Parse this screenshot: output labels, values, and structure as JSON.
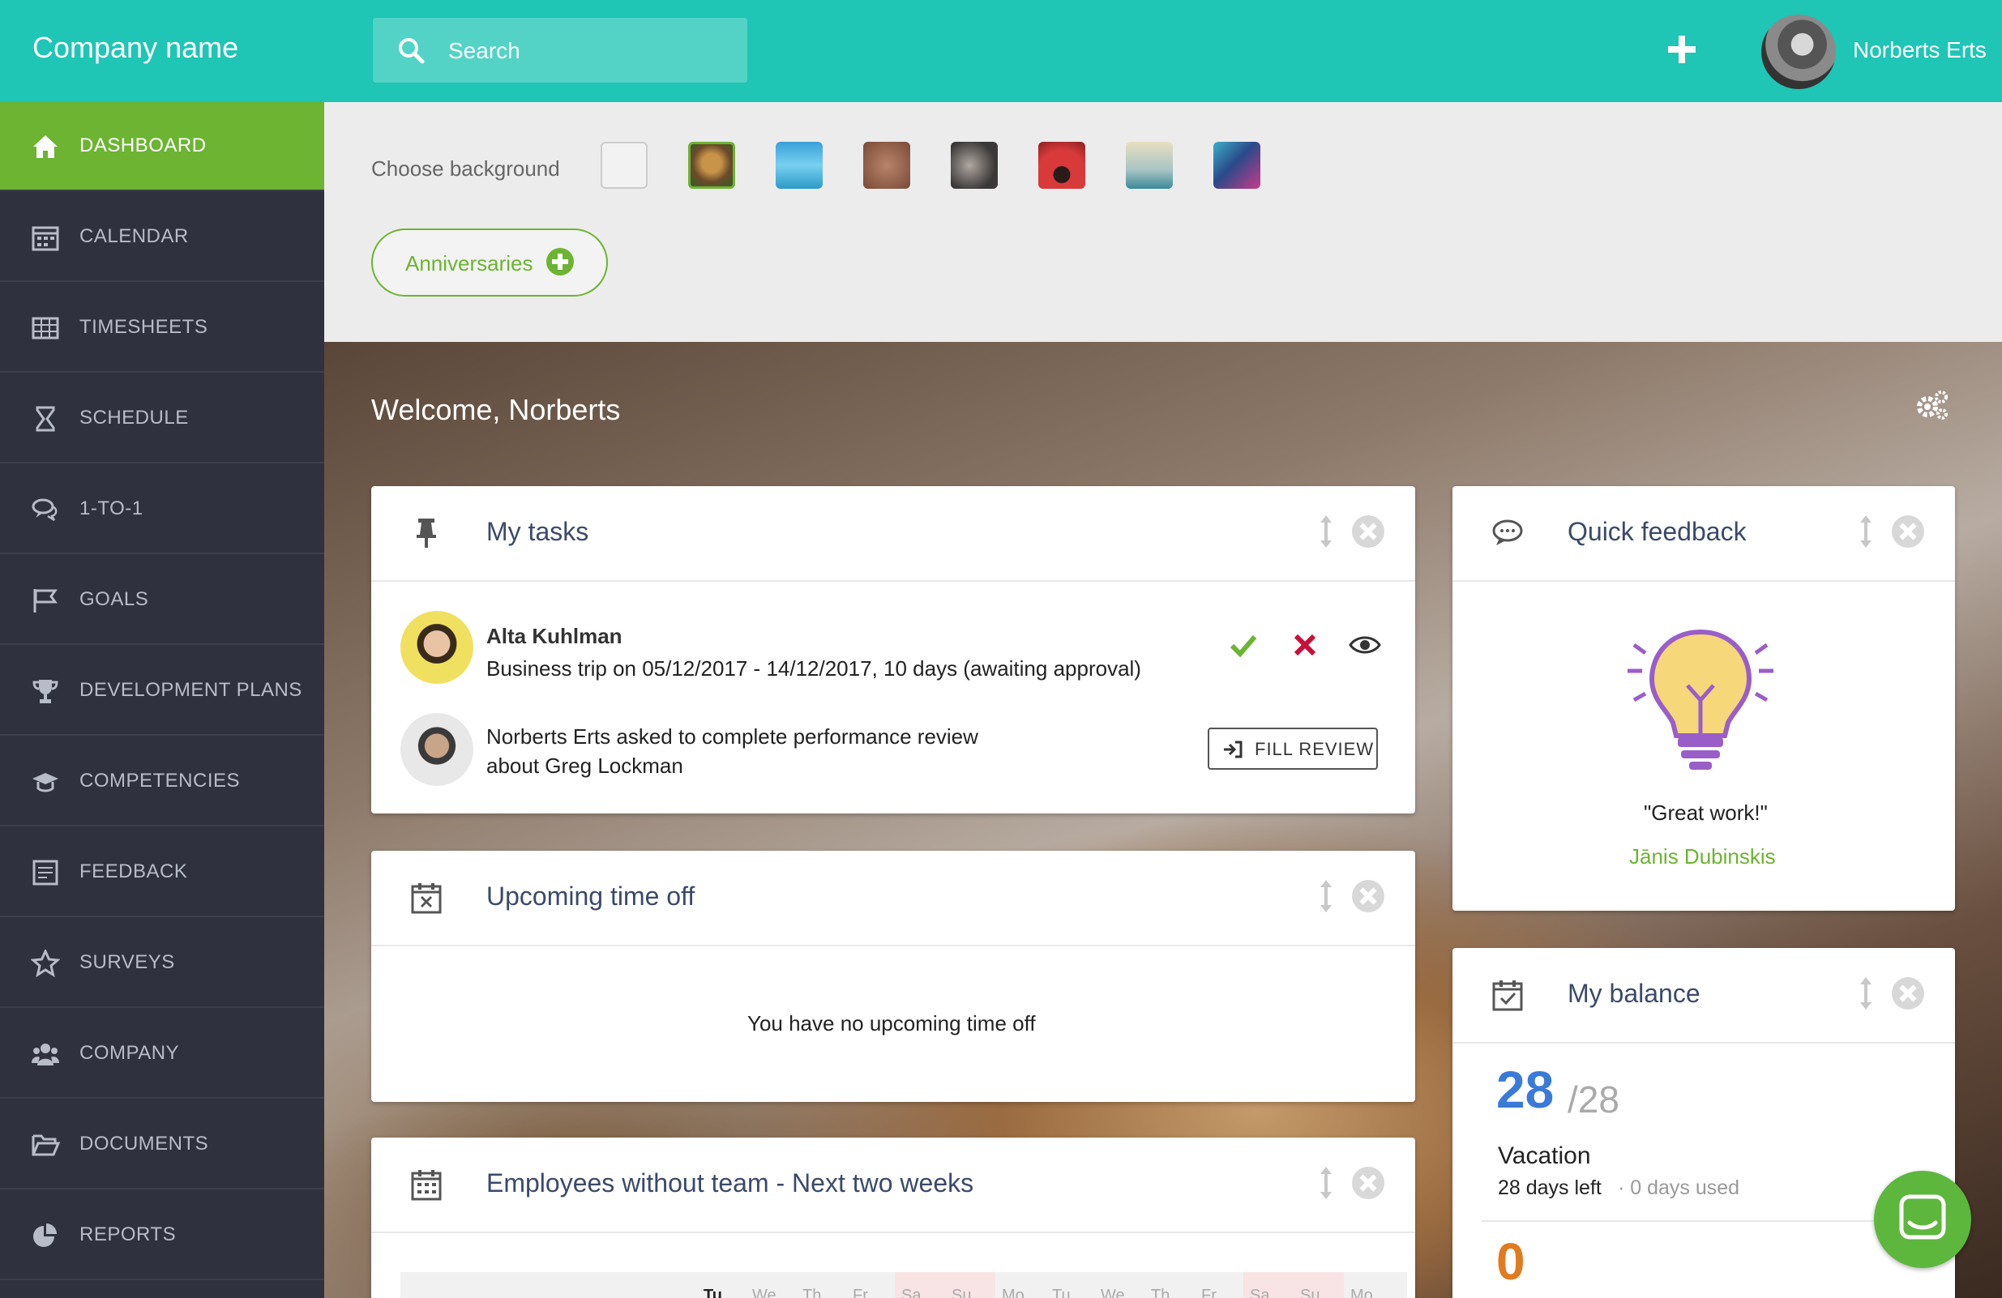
{
  "header": {
    "company": "Company name",
    "search_placeholder": "Search",
    "user_name": "Norberts Erts"
  },
  "sidebar": {
    "items": [
      {
        "label": "DASHBOARD",
        "icon": "home-icon"
      },
      {
        "label": "CALENDAR",
        "icon": "calendar-icon"
      },
      {
        "label": "TIMESHEETS",
        "icon": "table-icon"
      },
      {
        "label": "SCHEDULE",
        "icon": "hourglass-icon"
      },
      {
        "label": "1-TO-1",
        "icon": "chat-icon"
      },
      {
        "label": "GOALS",
        "icon": "flag-icon"
      },
      {
        "label": "DEVELOPMENT PLANS",
        "icon": "trophy-icon"
      },
      {
        "label": "COMPETENCIES",
        "icon": "graduation-cap-icon"
      },
      {
        "label": "FEEDBACK",
        "icon": "form-icon"
      },
      {
        "label": "SURVEYS",
        "icon": "star-icon"
      },
      {
        "label": "COMPANY",
        "icon": "users-icon"
      },
      {
        "label": "DOCUMENTS",
        "icon": "folder-icon"
      },
      {
        "label": "REPORTS",
        "icon": "pie-chart-icon"
      }
    ]
  },
  "background": {
    "label": "Choose background",
    "swatches": [
      "#f2f2f2",
      "#8a6a3a",
      "#4ab8e0",
      "#9a6a52",
      "#5a5858",
      "#c83a3a",
      "#a8c4c4",
      "#2a9aa8"
    ],
    "anniversaries_label": "Anniversaries"
  },
  "welcome": "Welcome, Norberts",
  "tasks": {
    "title": "My tasks",
    "items": [
      {
        "name": "Alta Kuhlman",
        "text": "Business trip on 05/12/2017 - 14/12/2017, 10 days (awaiting approval)"
      },
      {
        "line1": "Norberts Erts asked to complete performance review",
        "line2": "about Greg Lockman",
        "button": "FILL REVIEW"
      }
    ]
  },
  "timeoff": {
    "title": "Upcoming time off",
    "empty": "You have no upcoming time off"
  },
  "employees": {
    "title": "Employees without team - Next two weeks",
    "days": [
      "Tu",
      "We",
      "Th",
      "Fr",
      "Sa",
      "Su",
      "Mo",
      "Tu",
      "We",
      "Th",
      "Fr",
      "Sa",
      "Su",
      "Mo"
    ]
  },
  "feedback": {
    "title": "Quick feedback",
    "quote": "\"Great work!\"",
    "author": "Jānis Dubinskis"
  },
  "balance": {
    "title": "My balance",
    "value": "28",
    "total": "/28",
    "type": "Vacation",
    "left": "28 days left",
    "used": " · 0 days used",
    "second_value": "0"
  }
}
